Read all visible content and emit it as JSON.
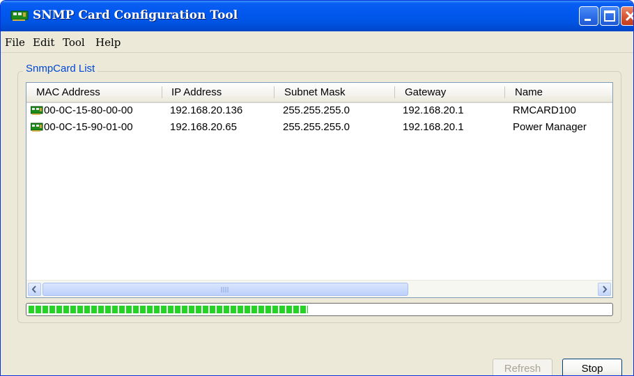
{
  "window": {
    "title": "SNMP Card Configuration Tool"
  },
  "menu": {
    "file": "File",
    "edit": "Edit",
    "tool": "Tool",
    "help": "Help"
  },
  "group": {
    "title": "SnmpCard List"
  },
  "table": {
    "headers": [
      "MAC Address",
      "IP Address",
      "Subnet Mask",
      "Gateway",
      "Name"
    ],
    "rows": [
      [
        "00-0C-15-80-00-00",
        "192.168.20.136",
        "255.255.255.0",
        "192.168.20.1",
        "RMCARD100"
      ],
      [
        "00-0C-15-90-01-00",
        "192.168.20.65",
        "255.255.255.0",
        "192.168.20.1",
        "Power Manager"
      ]
    ]
  },
  "progress": {
    "fraction": 0.48
  },
  "buttons": {
    "refresh": "Refresh",
    "stop": "Stop"
  },
  "colors": {
    "progress": "#24d424",
    "group_title": "#0046d5",
    "titlebar": "#0054e3"
  },
  "icons": {
    "app": "network-card-icon",
    "row": "network-card-icon"
  }
}
